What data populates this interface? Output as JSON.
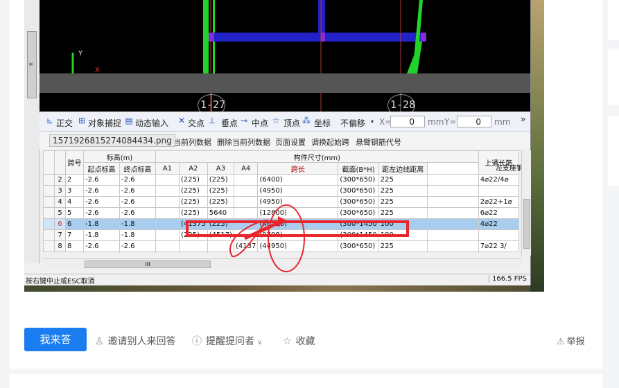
{
  "screenshot": {
    "axis_labels": [
      "1-27",
      "1-28"
    ],
    "axis_y": "Y",
    "axis_x": "X",
    "toolbar": {
      "items": [
        "正交",
        "对象捕捉",
        "动态输入",
        "交点",
        "垂点",
        "中点",
        "顶点",
        "坐标"
      ],
      "offset_select": "不偏移",
      "x_label": "X=",
      "x_value": "0",
      "x_unit": "mm",
      "y_label": "Y=",
      "y_value": "0",
      "y_unit": "mm",
      "more": "»"
    },
    "file_tip": "1571926815274084434.png",
    "toolbar2": [
      "入当前列数据",
      "删除当前列数据",
      "页面设置",
      "调换起始跨",
      "悬臂钢筋代号"
    ],
    "table": {
      "group_headers": {
        "elev": "标高(m)",
        "size": "构件尺寸(mm)",
        "top": "上通长筋",
        "left": "左支座钢"
      },
      "headers": [
        "跨号",
        "起点标高",
        "终点标高",
        "A1",
        "A2",
        "A3",
        "A4",
        "跨长",
        "截面(B*H)",
        "距左边线距离"
      ],
      "rows": [
        {
          "rn": "2",
          "span": "2",
          "s": "-2.6",
          "e": "-2.6",
          "a1": "",
          "a2": "(225)",
          "a3": "(225)",
          "a4": "",
          "len": "(6400)",
          "sec": "(300*650)",
          "dist": "225",
          "top": "",
          "left": "4⌀22/4⌀"
        },
        {
          "rn": "3",
          "span": "3",
          "s": "-2.6",
          "e": "-2.6",
          "a1": "",
          "a2": "(225)",
          "a3": "(225)",
          "a4": "",
          "len": "(4950)",
          "sec": "(300*650)",
          "dist": "225",
          "top": "",
          "left": ""
        },
        {
          "rn": "4",
          "span": "4",
          "s": "-2.6",
          "e": "-2.6",
          "a1": "",
          "a2": "(225)",
          "a3": "(225)",
          "a4": "",
          "len": "(4950)",
          "sec": "(300*650)",
          "dist": "225",
          "top": "",
          "left": "2⌀22+1⌀"
        },
        {
          "rn": "5",
          "span": "5",
          "s": "-2.6",
          "e": "-2.6",
          "a1": "",
          "a2": "(225)",
          "a3": "5640",
          "a4": "",
          "len": "(12800)",
          "sec": "(300*650)",
          "dist": "225",
          "top": "",
          "left": "6⌀22"
        },
        {
          "rn": "6",
          "span": "6",
          "s": "-1.8",
          "e": "-1.8",
          "a1": "",
          "a2": "(41375",
          "a3": "(225)",
          "a4": "",
          "len": "(46550)",
          "sec": "(300*1450",
          "dist": "100",
          "top": "",
          "left": "4⌀22"
        },
        {
          "rn": "7",
          "span": "7",
          "s": "-1.8",
          "e": "-1.8",
          "a1": "",
          "a2": "(225)",
          "a3": "(4517)",
          "a4": "",
          "len": "(9708)",
          "sec": "(300*1450",
          "dist": "100",
          "top": "",
          "left": ""
        },
        {
          "rn": "8",
          "span": "8",
          "s": "-2.6",
          "e": "-2.6",
          "a1": "",
          "a2": "",
          "a3": "",
          "a4": "(4137",
          "len": "(44950)",
          "sec": "(300*650)",
          "dist": "225",
          "top": "",
          "left": "7⌀22 3/"
        }
      ],
      "hscroll_label": "III"
    },
    "status_left": "按右键中止或ESC取消",
    "status_right": "166.5 FPS"
  },
  "actions": {
    "answer": "我来答",
    "invite": "邀请别人来回答",
    "remind": "提醒提问者",
    "collect": "收藏",
    "report": "举报"
  },
  "colors": {
    "accent": "#1a7df0",
    "annotation": "#e8262c",
    "selected_row": "#a9cdee"
  }
}
